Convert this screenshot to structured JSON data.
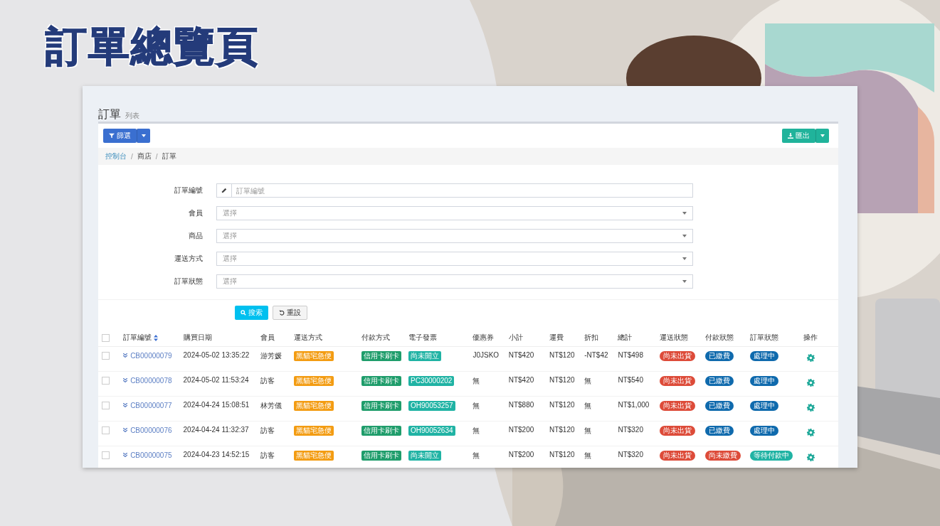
{
  "slide_title": "訂單總覽頁",
  "page": {
    "title": "訂單",
    "subtitle": "列表"
  },
  "toolbar": {
    "filter_button": "篩選",
    "export_button": "匯出"
  },
  "breadcrumb_separator": "/",
  "breadcrumb": [
    {
      "label": "控制台",
      "link": true
    },
    {
      "label": "商店",
      "link": false
    },
    {
      "label": "訂單",
      "link": false
    }
  ],
  "filters": [
    {
      "label": "訂單編號",
      "kind": "text",
      "placeholder": "訂單編號"
    },
    {
      "label": "會員",
      "kind": "select",
      "placeholder": "選擇"
    },
    {
      "label": "商品",
      "kind": "select",
      "placeholder": "選擇"
    },
    {
      "label": "運送方式",
      "kind": "select",
      "placeholder": "選擇"
    },
    {
      "label": "訂單狀態",
      "kind": "select",
      "placeholder": "選擇"
    }
  ],
  "form_buttons": {
    "search": "搜索",
    "reset": "重設"
  },
  "table": {
    "select_all": {
      "checked": false
    },
    "columns": [
      "訂單編號",
      "購買日期",
      "會員",
      "運送方式",
      "付款方式",
      "電子發票",
      "優惠券",
      "小計",
      "運費",
      "折扣",
      "總計",
      "運送狀態",
      "付款狀態",
      "訂單狀態",
      "操作"
    ],
    "rows": [
      {
        "checked": false,
        "order_no": "CB00000079",
        "date": "2024-05-02 13:35:22",
        "member": "游芳媛",
        "shipping": {
          "text": "黑貓宅急便",
          "color": "#f39c12"
        },
        "payment": {
          "text": "信用卡刷卡",
          "color": "#1f9d6b"
        },
        "invoice": {
          "text": "尚未開立",
          "color": "#20b3a4"
        },
        "coupon": "J0JSKO",
        "subtotal": "NT$420",
        "fee": "NT$120",
        "discount": "-NT$42",
        "total": "NT$498",
        "ship_status": {
          "text": "尚未出貨",
          "color": "#dd4b39"
        },
        "pay_status": {
          "text": "已繳費",
          "color": "#0f6aad"
        },
        "order_status": {
          "text": "處理中",
          "color": "#0f6aad"
        }
      },
      {
        "checked": false,
        "order_no": "CB00000078",
        "date": "2024-05-02 11:53:24",
        "member": "訪客",
        "shipping": {
          "text": "黑貓宅急便",
          "color": "#f39c12"
        },
        "payment": {
          "text": "信用卡刷卡",
          "color": "#1f9d6b"
        },
        "invoice": {
          "text": "PC30000202",
          "color": "#20b3a4"
        },
        "coupon": "無",
        "subtotal": "NT$420",
        "fee": "NT$120",
        "discount": "無",
        "total": "NT$540",
        "ship_status": {
          "text": "尚未出貨",
          "color": "#dd4b39"
        },
        "pay_status": {
          "text": "已繳費",
          "color": "#0f6aad"
        },
        "order_status": {
          "text": "處理中",
          "color": "#0f6aad"
        }
      },
      {
        "checked": false,
        "order_no": "CB00000077",
        "date": "2024-04-24 15:08:51",
        "member": "林芳儀",
        "shipping": {
          "text": "黑貓宅急便",
          "color": "#f39c12"
        },
        "payment": {
          "text": "信用卡刷卡",
          "color": "#1f9d6b"
        },
        "invoice": {
          "text": "OH90053257",
          "color": "#20b3a4"
        },
        "coupon": "無",
        "subtotal": "NT$880",
        "fee": "NT$120",
        "discount": "無",
        "total": "NT$1,000",
        "ship_status": {
          "text": "尚未出貨",
          "color": "#dd4b39"
        },
        "pay_status": {
          "text": "已繳費",
          "color": "#0f6aad"
        },
        "order_status": {
          "text": "處理中",
          "color": "#0f6aad"
        }
      },
      {
        "checked": false,
        "order_no": "CB00000076",
        "date": "2024-04-24 11:32:37",
        "member": "訪客",
        "shipping": {
          "text": "黑貓宅急便",
          "color": "#f39c12"
        },
        "payment": {
          "text": "信用卡刷卡",
          "color": "#1f9d6b"
        },
        "invoice": {
          "text": "OH90052634",
          "color": "#20b3a4"
        },
        "coupon": "無",
        "subtotal": "NT$200",
        "fee": "NT$120",
        "discount": "無",
        "total": "NT$320",
        "ship_status": {
          "text": "尚未出貨",
          "color": "#dd4b39"
        },
        "pay_status": {
          "text": "已繳費",
          "color": "#0f6aad"
        },
        "order_status": {
          "text": "處理中",
          "color": "#0f6aad"
        }
      },
      {
        "checked": false,
        "order_no": "CB00000075",
        "date": "2024-04-23 14:52:15",
        "member": "訪客",
        "shipping": {
          "text": "黑貓宅急便",
          "color": "#f39c12"
        },
        "payment": {
          "text": "信用卡刷卡",
          "color": "#1f9d6b"
        },
        "invoice": {
          "text": "尚未開立",
          "color": "#20b3a4"
        },
        "coupon": "無",
        "subtotal": "NT$200",
        "fee": "NT$120",
        "discount": "無",
        "total": "NT$320",
        "ship_status": {
          "text": "尚未出貨",
          "color": "#dd4b39"
        },
        "pay_status": {
          "text": "尚未繳費",
          "color": "#dd4b39"
        },
        "order_status": {
          "text": "等待付款中",
          "color": "#20b3a4"
        }
      }
    ]
  }
}
